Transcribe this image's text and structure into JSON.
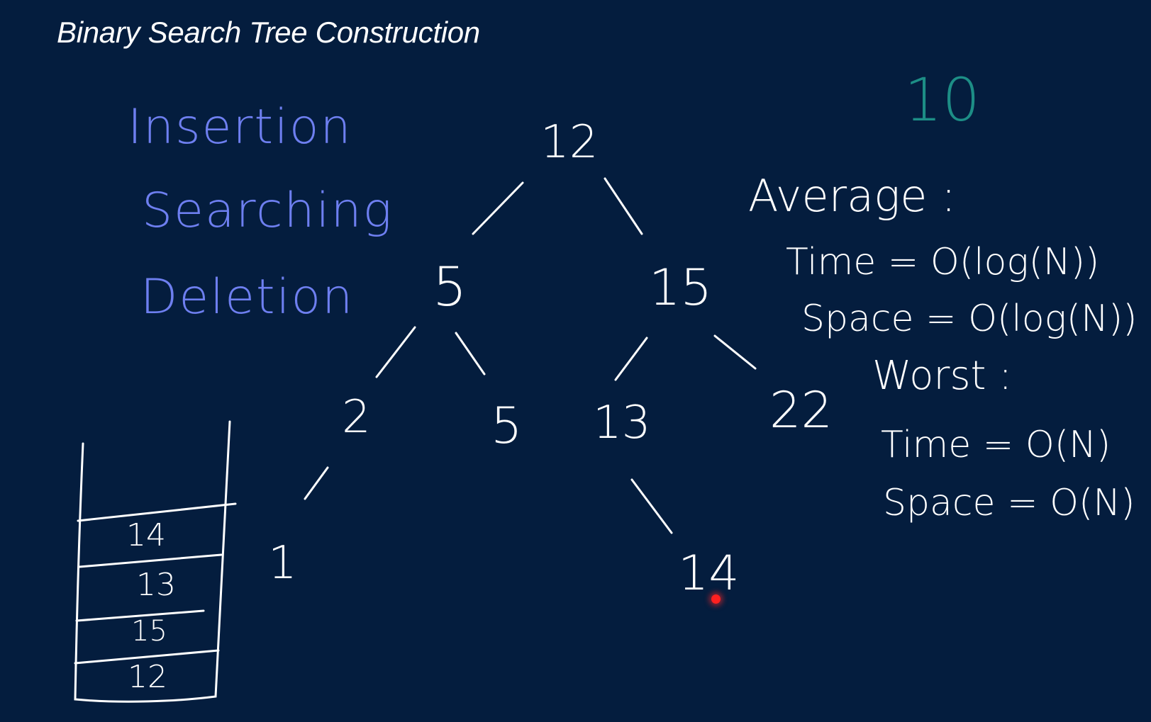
{
  "title": "Binary Search Tree Construction",
  "operations": [
    "Insertion",
    "Searching",
    "Deletion"
  ],
  "tree_nodes": {
    "root": "12",
    "left": "5",
    "right": "15",
    "left_left": "2",
    "left_right": "5",
    "right_left": "13",
    "right_right": "22",
    "left_left_left": "1",
    "right_left_right": "14"
  },
  "current_value": "10",
  "complexity": {
    "average_label": "Average :",
    "average_time": "Time = O(log(N))",
    "average_space": "Space = O(log(N))",
    "worst_label": "Worst :",
    "worst_time": "Time = O(N)",
    "worst_space": "Space = O(N)"
  },
  "stack": [
    "14",
    "13",
    "15",
    "12"
  ],
  "colors": {
    "background": "#041d3e",
    "ink_white": "#ffffff",
    "ink_blue": "#6e7ff0",
    "ink_teal": "#1d8e86",
    "pointer": "#ff2020"
  }
}
